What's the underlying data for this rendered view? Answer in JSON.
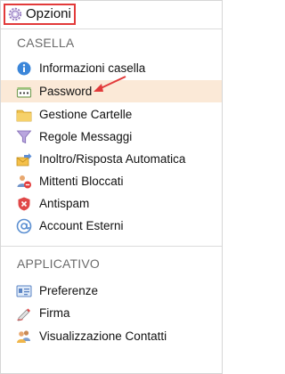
{
  "header": {
    "title": "Opzioni",
    "icon": "gear-icon"
  },
  "sections": [
    {
      "title": "CASELLA",
      "items": [
        {
          "label": "Informazioni casella",
          "icon": "info-icon"
        },
        {
          "label": "Password",
          "icon": "password-icon",
          "active": true
        },
        {
          "label": "Gestione Cartelle",
          "icon": "folder-icon"
        },
        {
          "label": "Regole Messaggi",
          "icon": "filter-icon"
        },
        {
          "label": "Inoltro/Risposta Automatica",
          "icon": "forward-mail-icon"
        },
        {
          "label": "Mittenti Bloccati",
          "icon": "blocked-users-icon"
        },
        {
          "label": "Antispam",
          "icon": "antispam-icon"
        },
        {
          "label": "Account Esterni",
          "icon": "at-sign-icon"
        }
      ]
    },
    {
      "title": "APPLICATIVO",
      "items": [
        {
          "label": "Preferenze",
          "icon": "preferences-card-icon"
        },
        {
          "label": "Firma",
          "icon": "signature-pen-icon"
        },
        {
          "label": "Visualizzazione Contatti",
          "icon": "contacts-icon"
        }
      ]
    }
  ],
  "colors": {
    "highlight_bg": "#fbe9d7",
    "annotation_red": "#e23a3a",
    "section_text": "#6b6b6b"
  }
}
